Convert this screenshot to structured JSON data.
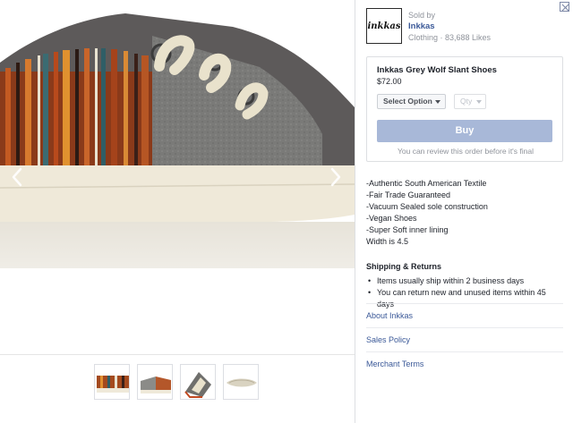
{
  "gallery": {
    "prev_icon": "chevron-left-icon",
    "next_icon": "chevron-right-icon",
    "thumbnails": [
      "shoe-side-view",
      "shoe-pair-view",
      "shoe-top-view",
      "shoe-sole-view"
    ]
  },
  "panel": {
    "close_icon": "close-icon",
    "seller": {
      "logo_text": "inkkas",
      "sold_by_label": "Sold by",
      "name": "Inkkas",
      "meta": "Clothing · 83,688 Likes"
    },
    "product": {
      "title": "Inkkas Grey Wolf Slant Shoes",
      "price": "$72.00",
      "option_select": "Select Option",
      "qty_select": "Qty",
      "buy_label": "Buy",
      "review_note": "You can review this order before it's final"
    },
    "features": [
      "-Authentic South American Textile",
      "-Fair Trade Guaranteed",
      "-Vacuum Sealed sole construction",
      "-Vegan Shoes",
      "-Super Soft inner lining",
      "Width is 4.5"
    ],
    "shipping": {
      "title": "Shipping & Returns",
      "items": [
        "Items usually ship within 2 business days",
        "You can return new and unused items within 45 days"
      ]
    },
    "links": [
      "About Inkkas",
      "Sales Policy",
      "Merchant Terms"
    ]
  },
  "colors": {
    "link": "#3b5998",
    "buy_button": "#a8b8d8",
    "muted_text": "#90949c"
  }
}
